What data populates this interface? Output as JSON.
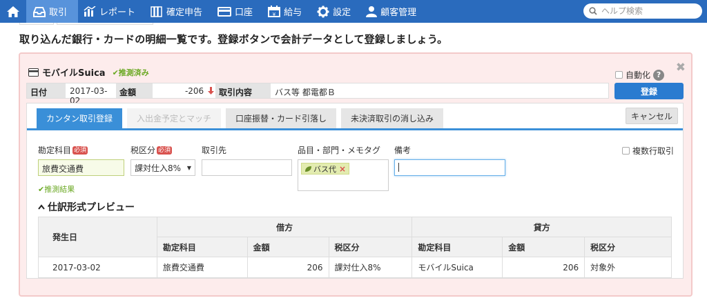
{
  "nav": {
    "items": [
      {
        "label": "取引",
        "icon": "inbox-icon",
        "active": true
      },
      {
        "label": "レポート",
        "icon": "bar-chart-icon"
      },
      {
        "label": "確定申告",
        "icon": "books-icon"
      },
      {
        "label": "口座",
        "icon": "credit-card-icon"
      },
      {
        "label": "給与",
        "icon": "calendar-icon"
      },
      {
        "label": "設定",
        "icon": "gear-icon"
      },
      {
        "label": "顧客管理",
        "icon": "user-icon"
      }
    ],
    "search_placeholder": "ヘルプ検索"
  },
  "heading": "取り込んだ銀行・カードの明細一覧です。登録ボタンで会計データとして登録しましょう。",
  "card": {
    "account_name": "モバイルSuica",
    "guess_status": "✔推測済み",
    "auto_label": "自動化",
    "help": "?",
    "close": "✖",
    "info": {
      "date_label": "日付",
      "date_value": "2017-03-02",
      "amount_label": "金額",
      "amount_value": "-206",
      "desc_label": "取引内容",
      "desc_value": "バス等 都電都Ｂ"
    },
    "register_button": "登録"
  },
  "form": {
    "tabs": [
      {
        "label": "カンタン取引登録",
        "state": "active"
      },
      {
        "label": "入出金予定とマッチ",
        "state": "disabled"
      },
      {
        "label": "口座振替・カード引落し",
        "state": "normal"
      },
      {
        "label": "未決済取引の消し込み",
        "state": "normal"
      }
    ],
    "cancel_button": "キャンセル",
    "required_badge": "必須",
    "fields": {
      "account_label": "勘定科目",
      "account_value": "旅費交通費",
      "tax_label": "税区分",
      "tax_value": "課対仕入8%",
      "partner_label": "取引先",
      "partner_value": "",
      "tag_label": "品目・部門・メモタグ",
      "tag_value": "バス代",
      "note_label": "備考",
      "note_value": ""
    },
    "guess_result": "✔推測結果",
    "multi_row_label": "複数行取引"
  },
  "preview": {
    "title": "仕訳形式プレビュー",
    "headers": {
      "date": "発生日",
      "debit": "借方",
      "credit": "貸方",
      "account": "勘定科目",
      "amount": "金額",
      "tax": "税区分"
    },
    "row": {
      "date": "2017-03-02",
      "debit_account": "旅費交通費",
      "debit_amount": "206",
      "debit_tax": "課対仕入8%",
      "credit_account": "モバイルSuica",
      "credit_amount": "206",
      "credit_tax": "対象外"
    }
  },
  "colors": {
    "nav_bg": "#2a6bbd",
    "nav_active": "#5893db",
    "panel_bg": "#fdecec",
    "tab_active": "#3a8fd8",
    "register": "#2a7bd0",
    "guess_green": "#6aa822",
    "required_red": "#d9534f"
  }
}
